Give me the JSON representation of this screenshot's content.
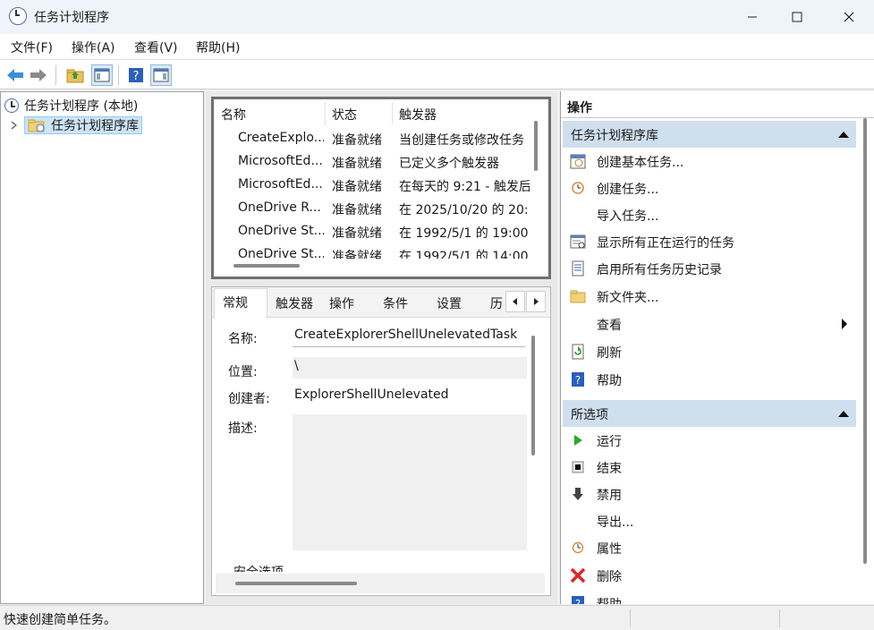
{
  "window": {
    "title": "任务计划程序"
  },
  "menu": [
    "文件(F)",
    "操作(A)",
    "查看(V)",
    "帮助(H)"
  ],
  "tree": {
    "root": "任务计划程序 (本地)",
    "child": "任务计划程序库"
  },
  "task_list": {
    "columns": [
      "名称",
      "状态",
      "触发器"
    ],
    "rows": [
      {
        "name": "CreateExplo...",
        "status": "准备就绪",
        "trigger": "当创建任务或修改任务"
      },
      {
        "name": "MicrosoftEd...",
        "status": "准备就绪",
        "trigger": "已定义多个触发器"
      },
      {
        "name": "MicrosoftEd...",
        "status": "准备就绪",
        "trigger": "在每天的 9:21 - 触发后"
      },
      {
        "name": "OneDrive R...",
        "status": "准备就绪",
        "trigger": "在 2025/10/20 的 20:"
      },
      {
        "name": "OneDrive St...",
        "status": "准备就绪",
        "trigger": "在 1992/5/1 的 19:00"
      },
      {
        "name": "OneDrive St...",
        "status": "准备就绪",
        "trigger": "在 1992/5/1 的 14:00"
      }
    ]
  },
  "details": {
    "tabs": [
      "常规",
      "触发器",
      "操作",
      "条件",
      "设置",
      "历"
    ],
    "name_label": "名称:",
    "name_value": "CreateExplorerShellUnelevatedTask",
    "location_label": "位置:",
    "location_value": "\\",
    "author_label": "创建者:",
    "author_value": "ExplorerShellUnelevated",
    "desc_label": "描述:",
    "desc_value": "",
    "security_label": "安全选项"
  },
  "actions_panel": {
    "header": "操作",
    "section1": {
      "title": "任务计划程序库",
      "items": [
        "创建基本任务...",
        "创建任务...",
        "导入任务...",
        "显示所有正在运行的任务",
        "启用所有任务历史记录",
        "新文件夹...",
        "查看",
        "刷新",
        "帮助"
      ]
    },
    "section2": {
      "title": "所选项",
      "items": [
        "运行",
        "结束",
        "禁用",
        "导出...",
        "属性",
        "删除",
        "帮助"
      ]
    }
  },
  "status": {
    "text": "快速创建简单任务。"
  }
}
